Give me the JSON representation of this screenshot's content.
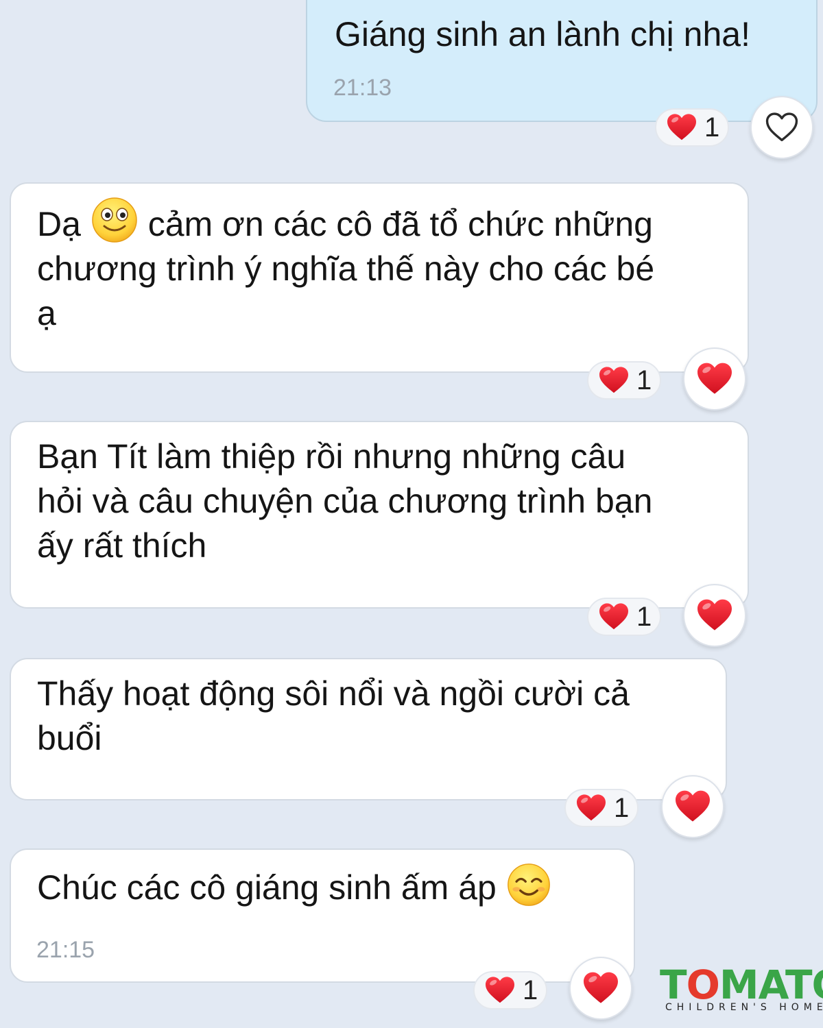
{
  "messages": [
    {
      "id": "m1",
      "direction": "sent",
      "text": "Giáng sinh an lành chị nha!",
      "time": "21:13",
      "reaction_count": "1",
      "my_reaction": "heart-outline"
    },
    {
      "id": "m2",
      "direction": "received",
      "text_before_emoji": "Dạ",
      "emoji": "smiling-face-emoji",
      "text_after_emoji": "cảm ơn các cô đã tổ chức những",
      "text_rest": "chương trình ý nghĩa thế này cho các bé\nạ",
      "reaction_count": "1",
      "my_reaction": "heart-filled"
    },
    {
      "id": "m3",
      "direction": "received",
      "text": "Bạn Tít làm thiệp rồi nhưng những câu\nhỏi và câu chuyện của chương trình bạn\nấy rất thích",
      "reaction_count": "1",
      "my_reaction": "heart-filled"
    },
    {
      "id": "m4",
      "direction": "received",
      "text": "Thấy hoạt động sôi nổi và ngồi cười cả\nbuổi",
      "reaction_count": "1",
      "my_reaction": "heart-filled"
    },
    {
      "id": "m5",
      "direction": "received",
      "text": "Chúc các cô giáng sinh ấm áp",
      "emoji": "smiling-face-with-smiling-eyes-emoji",
      "time": "21:15",
      "reaction_count": "1",
      "my_reaction": "heart-filled"
    }
  ],
  "logo": {
    "word_start": "T",
    "word_o": "O",
    "word_end": "MATO",
    "subtitle": "CHILDREN'S HOME"
  },
  "colors": {
    "background": "#e2e9f3",
    "sent_bubble": "#d4edfb",
    "received_bubble": "#ffffff",
    "heart": "#e8202f",
    "logo_green": "#3aa548",
    "logo_red": "#e53a2c"
  }
}
